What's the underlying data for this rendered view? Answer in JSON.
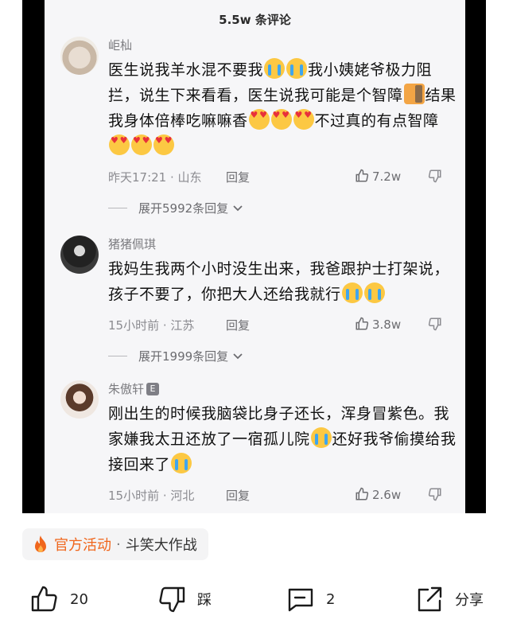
{
  "panel": {
    "title": "5.5w 条评论"
  },
  "comments": [
    {
      "username": "岠杣",
      "segments": [
        "医生说我羊水混不要我",
        "我小姨姥爷极力阻拦，说生下来看看，医生说我可能是个智障",
        "结果我身体倍棒吃嘛嘛香",
        "不过真的有点智障"
      ],
      "time_location": "昨天17:21 · 山东",
      "reply_label": "回复",
      "likes": "7.2w",
      "expand_label": "展开5992条回复"
    },
    {
      "username": "猪猪佩琪",
      "segments": [
        "我妈生我两个小时没生出来，我爸跟护士打架说，孩子不要了，你把大人还给我就行"
      ],
      "time_location": "15小时前 · 江苏",
      "reply_label": "回复",
      "likes": "3.8w",
      "expand_label": "展开1999条回复"
    },
    {
      "username": "朱傲轩",
      "badge": "E",
      "segments": [
        "刚出生的时候我脑袋比身子还长，浑身冒紫色。我家嫌我太丑还放了一宿孤儿院",
        "还好我爷偷摸给我接回来了"
      ],
      "time_location": "15小时前 · 河北",
      "reply_label": "回复",
      "likes": "2.6w"
    }
  ],
  "activity": {
    "tag": "官方活动",
    "separator": "·",
    "title": "斗笑大作战"
  },
  "actions": {
    "like_count": "20",
    "dislike_label": "踩",
    "comment_count": "2",
    "share_label": "分享"
  },
  "colors": {
    "accent": "#f0661c",
    "panel_bg": "#f6f6f8",
    "letterbox": "#000000"
  }
}
